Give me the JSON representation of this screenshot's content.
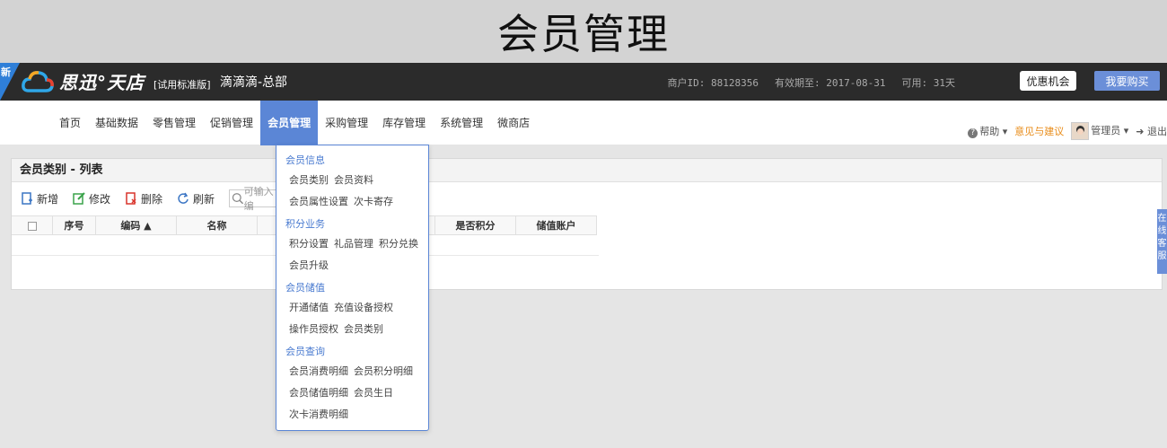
{
  "caption": "会员管理",
  "header": {
    "new_flag": "新",
    "brand": "思迅",
    "brand_suffix": "天店",
    "edition": "[试用标准版]",
    "store": "滴滴滴-总部",
    "merchant_id": "商户ID: 88128356",
    "expiry": "有效期至: 2017-08-31",
    "available": "可用: 31天",
    "offer_button": "优惠机会",
    "buy_button": "我要购买"
  },
  "nav": {
    "items": [
      "首页",
      "基础数据",
      "零售管理",
      "促销管理",
      "会员管理",
      "采购管理",
      "库存管理",
      "系统管理",
      "微商店"
    ],
    "active_index": 4,
    "help": "帮助",
    "feedback": "意见与建议",
    "user": "管理员",
    "logout": "退出"
  },
  "panel": {
    "title": "会员类别 - 列表",
    "toolbar": {
      "add": "新增",
      "edit": "修改",
      "delete": "删除",
      "refresh": "刷新",
      "search_placeholder": "可输入编"
    },
    "columns": [
      "序号",
      "编码 ▲",
      "名称",
      "",
      "是否积分",
      "储值账户"
    ]
  },
  "side_tab": "在线客服",
  "dropdown": {
    "groups": [
      {
        "title": "会员信息",
        "rows": [
          [
            "会员类别",
            "会员资料"
          ],
          [
            "会员属性设置",
            "次卡寄存"
          ]
        ]
      },
      {
        "title": "积分业务",
        "rows": [
          [
            "积分设置",
            "礼品管理",
            "积分兑换"
          ],
          [
            "会员升级"
          ]
        ]
      },
      {
        "title": "会员储值",
        "rows": [
          [
            "开通储值",
            "充值设备授权"
          ],
          [
            "操作员授权",
            "会员类别"
          ]
        ]
      },
      {
        "title": "会员查询",
        "rows": [
          [
            "会员消费明细",
            "会员积分明细"
          ],
          [
            "会员储值明细",
            "会员生日"
          ],
          [
            "次卡消费明细"
          ]
        ]
      }
    ]
  }
}
